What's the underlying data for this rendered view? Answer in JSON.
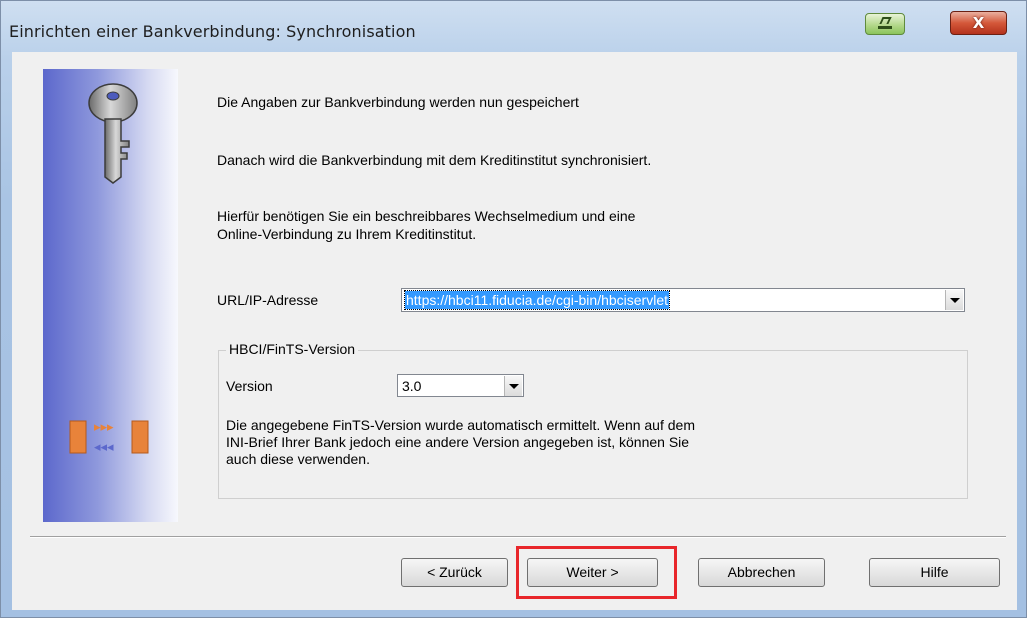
{
  "window": {
    "title": "Einrichten einer Bankverbindung: Synchronisation",
    "minimize_icon": "minimize-icon",
    "close_glyph": "X"
  },
  "content": {
    "line1": "Die Angaben zur Bankverbindung werden nun gespeichert",
    "line2": "Danach wird die Bankverbindung mit dem Kreditinstitut synchronisiert.",
    "line3a": "Hierfür benötigen Sie ein beschreibbares Wechselmedium und eine",
    "line3b": "Online-Verbindung zu Ihrem Kreditinstitut."
  },
  "url_field": {
    "label": "URL/IP-Adresse",
    "value": "https://hbci11.fiducia.de/cgi-bin/hbciservlet"
  },
  "version_group": {
    "title": "HBCI/FinTS-Version",
    "version_label": "Version",
    "version_value": "3.0",
    "info_line1": "Die angegebene FinTS-Version wurde automatisch ermittelt. Wenn auf dem",
    "info_line2": "INI-Brief Ihrer Bank jedoch eine andere Version angegeben ist, können Sie",
    "info_line3": "auch diese verwenden."
  },
  "buttons": {
    "back": "< Zurück",
    "next": "Weiter >",
    "cancel": "Abbrechen",
    "help": "Hilfe"
  },
  "side_icons": {
    "top": "key-icon",
    "bottom": "sync-arrows-icon"
  },
  "colors": {
    "highlight": "#e8262b",
    "selection": "#3399ff"
  }
}
